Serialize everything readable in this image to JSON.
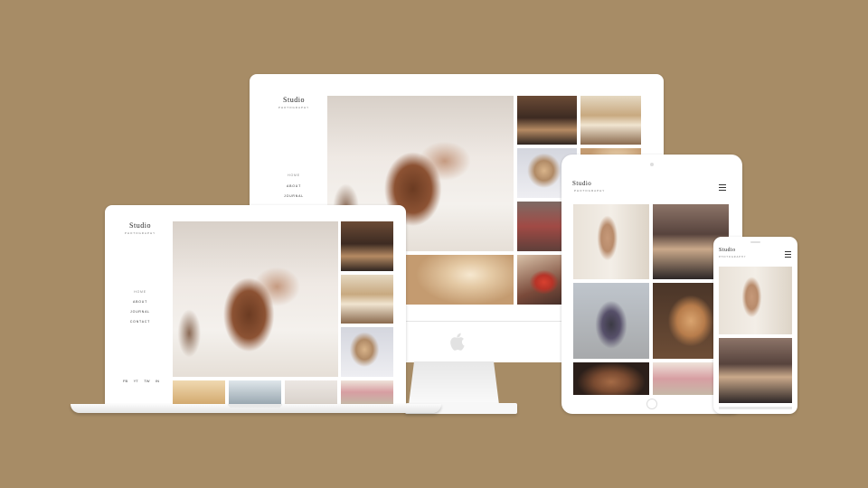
{
  "brand": {
    "name": "Studio",
    "tagline": "PHOTOGRAPHY"
  },
  "desktop": {
    "nav": [
      "HOME",
      "ABOUT",
      "JOURNAL"
    ]
  },
  "laptop": {
    "nav": [
      "HOME",
      "ABOUT",
      "JOURNAL",
      "CONTACT"
    ],
    "social": [
      "FB",
      "YT",
      "TW",
      "IN"
    ]
  },
  "colors": {
    "background": "#a78c66",
    "device": "#ffffff"
  },
  "icons": {
    "menu": "hamburger-menu-icon",
    "apple": "apple-logo-icon"
  }
}
